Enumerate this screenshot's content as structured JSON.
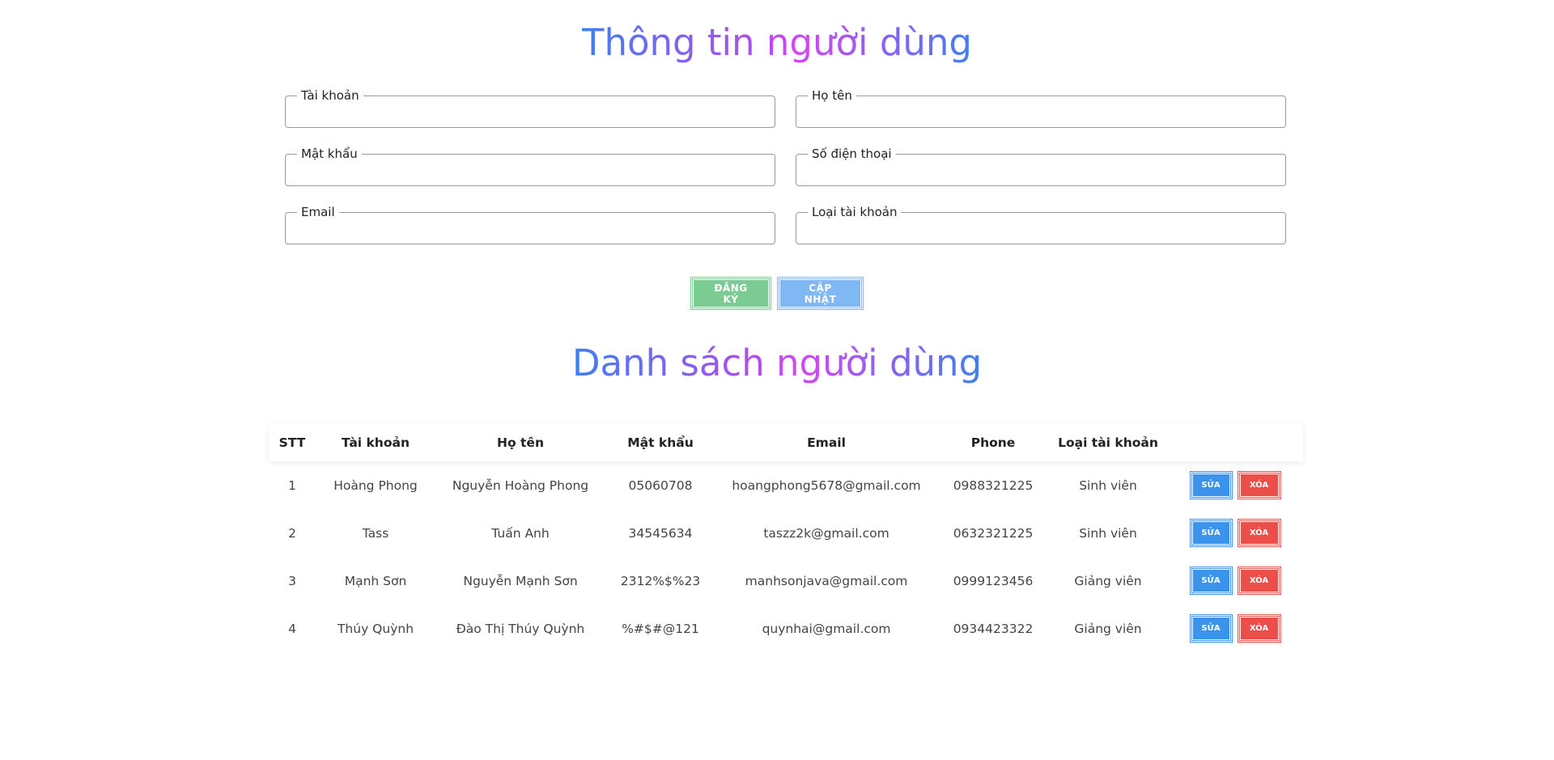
{
  "form": {
    "title": "Thông tin người dùng",
    "fields": {
      "account": {
        "label": "Tài khoản",
        "value": ""
      },
      "fullname": {
        "label": "Họ tên",
        "value": ""
      },
      "password": {
        "label": "Mật khẩu",
        "value": ""
      },
      "phone": {
        "label": "Số điện thoại",
        "value": ""
      },
      "email": {
        "label": "Email",
        "value": ""
      },
      "account_type": {
        "label": "Loại tài khoản",
        "value": ""
      }
    },
    "register_label": "ĐĂNG KÝ",
    "update_label": "CẬP NHẬT"
  },
  "list": {
    "title": "Danh sách người dùng",
    "headers": {
      "stt": "STT",
      "account": "Tài khoản",
      "fullname": "Họ tên",
      "password": "Mật khẩu",
      "email": "Email",
      "phone": "Phone",
      "type": "Loại tài khoản"
    },
    "edit_label": "SỬA",
    "delete_label": "XÓA",
    "rows": [
      {
        "stt": "1",
        "account": "Hoàng Phong",
        "fullname": "Nguyễn Hoàng Phong",
        "password": "05060708",
        "email": "hoangphong5678@gmail.com",
        "phone": "0988321225",
        "type": "Sinh viên"
      },
      {
        "stt": "2",
        "account": "Tass",
        "fullname": "Tuấn Anh",
        "password": "34545634",
        "email": "taszz2k@gmail.com",
        "phone": "0632321225",
        "type": "Sinh viên"
      },
      {
        "stt": "3",
        "account": "Mạnh Sơn",
        "fullname": "Nguyễn Mạnh Sơn",
        "password": "2312%$%23",
        "email": "manhsonjava@gmail.com",
        "phone": "0999123456",
        "type": "Giảng viên"
      },
      {
        "stt": "4",
        "account": "Thúy Quỳnh",
        "fullname": "Đào Thị Thúy Quỳnh",
        "password": "%#$#@121",
        "email": "quynhai@gmail.com",
        "phone": "0934423322",
        "type": "Giảng viên"
      }
    ]
  },
  "colors": {
    "title_gradient": [
      "#3f7ff2",
      "#d447f2"
    ],
    "register_button": "#7ccb93",
    "update_button": "#7fb8f5",
    "edit_button": "#3b93eb",
    "delete_button": "#ec4e4a"
  }
}
